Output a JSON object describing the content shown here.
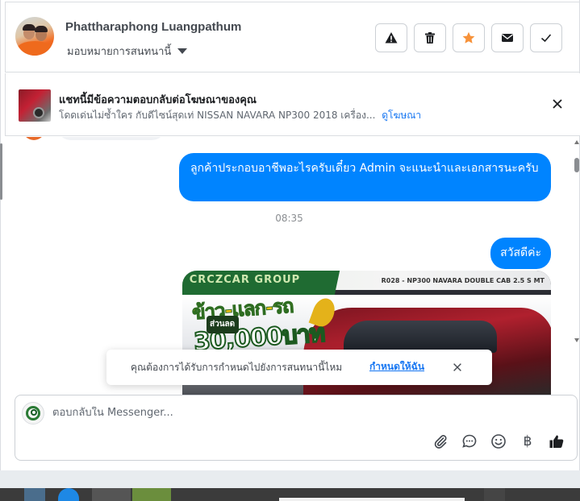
{
  "header": {
    "contact_name": "Phattharaphong Luangpathum",
    "assign_label": "มอบหมายการสนทนานี้",
    "actions": [
      {
        "name": "report-spam",
        "icon": "warning-icon"
      },
      {
        "name": "delete",
        "icon": "trash-icon"
      },
      {
        "name": "follow-up",
        "icon": "star-icon",
        "color": "#f7923a"
      },
      {
        "name": "mark-unread",
        "icon": "envelope-icon"
      },
      {
        "name": "mark-done",
        "icon": "checkmark-icon"
      }
    ]
  },
  "ad_banner": {
    "title": "แชทนี้มีข้อความตอบกลับต่อโฆษณาของคุณ",
    "subtitle": "โดดเด่นไม่ซ้ำใคร กับดีไซน์สุดเท่ NISSAN NAVARA NP300 2018 เครื่อง...",
    "link": "ดูโฆษณา"
  },
  "messages": [
    {
      "direction": "outgoing",
      "text": "ลูกค้าประกอบอาชีพอะไรครับเดี๋ยว Admin จะแนะนำและเอกสารนะครับ"
    },
    {
      "direction": "outgoing",
      "text": "สวัสดีค่ะ"
    }
  ],
  "timestamp": "08:35",
  "image_message": {
    "banner_text": "CRCZCAR GROUP",
    "model_text": "R028 - NP300 NAVARA DOUBLE CAB 2.5 S MT",
    "promo_line1": "ข้าว-แลก-รถ",
    "promo_badge": "ส่วนลด",
    "promo_line2": "30,000บาท"
  },
  "toast": {
    "text": "คุณต้องการได้รับการกำหนดไปยังการสนทนานี้ไหม",
    "link": "กำหนดให้ฉัน"
  },
  "composer": {
    "placeholder": "ตอบกลับใน Messenger...",
    "tools": [
      "paperclip-icon",
      "chat-bubble-icon",
      "emoji-icon",
      "baht-icon",
      "thumbs-up-icon"
    ],
    "baht_symbol": "฿"
  },
  "colors": {
    "accent": "#0084ff",
    "link": "#1877f2",
    "star": "#f7923a"
  }
}
